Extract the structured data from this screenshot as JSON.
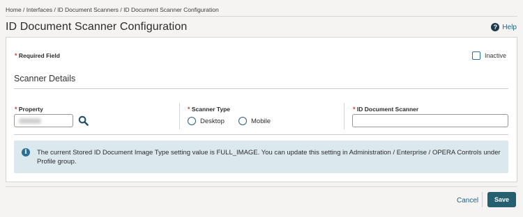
{
  "breadcrumb": "Home / Interfaces / ID Document Scanners / ID Document Scanner Configuration",
  "page_title": "ID Document Scanner Configuration",
  "help_label": "Help",
  "form": {
    "required_star": "*",
    "required_label": "Required Field",
    "inactive_label": "Inactive",
    "inactive_checked": false,
    "section_title": "Scanner Details",
    "property": {
      "label": "Property",
      "value": ""
    },
    "scanner_type": {
      "label": "Scanner Type",
      "options": [
        "Desktop",
        "Mobile"
      ],
      "selected": null
    },
    "id_document_scanner": {
      "label": "ID Document Scanner",
      "value": ""
    }
  },
  "info_message": "The current Stored ID Document Image Type setting value is FULL_IMAGE. You can update this setting in Administration / Enterprise / OPERA Controls under Profile group.",
  "footer": {
    "cancel_label": "Cancel",
    "save_label": "Save"
  },
  "colors": {
    "accent": "#24606f",
    "required": "#c74634",
    "info_bg": "#dbe9ef",
    "link": "#1f5f7f"
  }
}
